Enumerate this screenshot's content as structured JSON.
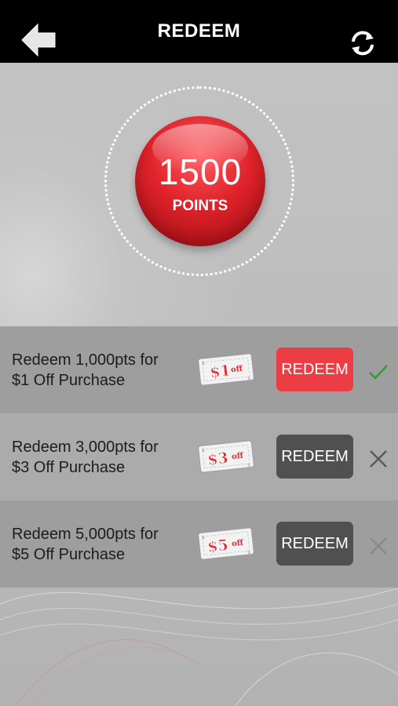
{
  "header": {
    "title": "REDEEM",
    "back_icon": "arrow-left-icon",
    "refresh_icon": "refresh-icon"
  },
  "points": {
    "value": "1500",
    "label": "POINTS"
  },
  "offers": [
    {
      "line1": "Redeem 1,000pts for",
      "line2": "$1 Off Purchase",
      "coupon_amount": "$1",
      "coupon_suffix": "off",
      "button_label": "REDEEM",
      "available": true,
      "status_icon": "check-icon"
    },
    {
      "line1": "Redeem 3,000pts for",
      "line2": "$3 Off Purchase",
      "coupon_amount": "$3",
      "coupon_suffix": "off",
      "button_label": "REDEEM",
      "available": false,
      "status_icon": "close-icon"
    },
    {
      "line1": "Redeem 5,000pts for",
      "line2": "$5 Off Purchase",
      "coupon_amount": "$5",
      "coupon_suffix": "off",
      "button_label": "REDEEM",
      "available": false,
      "status_icon": "close-icon"
    }
  ],
  "colors": {
    "accent_red": "#ec3d44",
    "disabled_button": "#505050",
    "check_green": "#2e9e2e"
  }
}
